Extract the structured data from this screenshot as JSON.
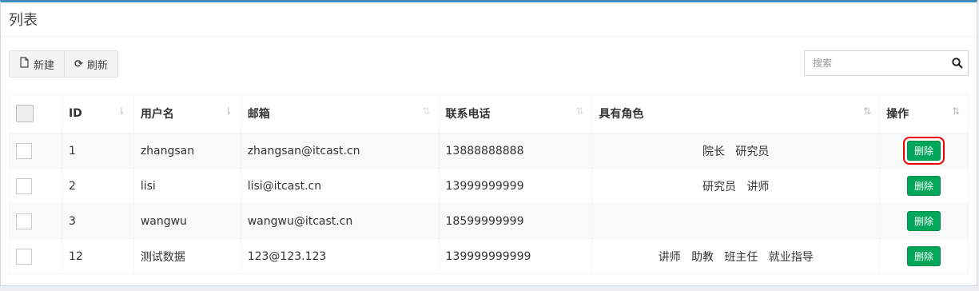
{
  "box": {
    "title": "列表"
  },
  "toolbar": {
    "new_label": "新建",
    "refresh_label": "刷新"
  },
  "search": {
    "placeholder": "搜索"
  },
  "table": {
    "headers": {
      "id": "ID",
      "username": "用户名",
      "email": "邮箱",
      "phone": "联系电话",
      "roles": "具有角色",
      "action": "操作"
    },
    "rows": [
      {
        "id": "1",
        "username": "zhangsan",
        "email": "zhangsan@itcast.cn",
        "phone": "13888888888",
        "roles": "院长   研究员",
        "action": "删除"
      },
      {
        "id": "2",
        "username": "lisi",
        "email": "lisi@itcast.cn",
        "phone": "13999999999",
        "roles": "研究员   讲师",
        "action": "删除"
      },
      {
        "id": "3",
        "username": "wangwu",
        "email": "wangwu@itcast.cn",
        "phone": "18599999999",
        "roles": "",
        "action": "删除"
      },
      {
        "id": "12",
        "username": "测试数据",
        "email": "123@123.123",
        "phone": "139999999999",
        "roles": "讲师   助教   班主任   就业指导",
        "action": "删除"
      }
    ]
  },
  "colors": {
    "accent": "#3c8dbc",
    "delete_button": "#00a65a",
    "highlight": "#e00000"
  }
}
